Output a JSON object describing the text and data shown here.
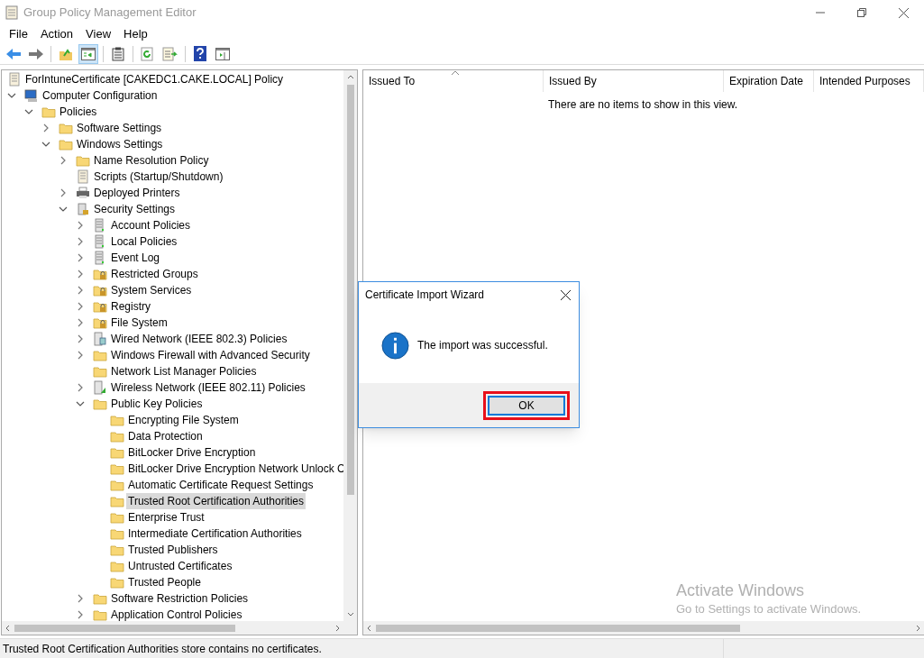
{
  "window": {
    "title": "Group Policy Management Editor"
  },
  "menu": [
    "File",
    "Action",
    "View",
    "Help"
  ],
  "toolbar": [
    {
      "kind": "back",
      "pressed": false
    },
    {
      "kind": "forward",
      "pressed": false
    },
    {
      "kind": "separator"
    },
    {
      "kind": "up",
      "pressed": false
    },
    {
      "kind": "tree",
      "pressed": true
    },
    {
      "kind": "separator"
    },
    {
      "kind": "properties",
      "pressed": false
    },
    {
      "kind": "separator"
    },
    {
      "kind": "refresh",
      "pressed": false
    },
    {
      "kind": "export",
      "pressed": false
    },
    {
      "kind": "separator"
    },
    {
      "kind": "help",
      "pressed": false
    },
    {
      "kind": "pane",
      "pressed": false
    }
  ],
  "tree": [
    {
      "label": "ForIntuneCertificate [CAKEDC1.CAKE.LOCAL] Policy",
      "kind": "document",
      "selected": false,
      "children": [
        {
          "label": "Computer Configuration",
          "kind": "computer",
          "expanded": true,
          "selected": false,
          "children": [
            {
              "label": "Policies",
              "kind": "folder",
              "expanded": true,
              "selected": false,
              "children": [
                {
                  "label": "Software Settings",
                  "kind": "folder",
                  "expanded": false,
                  "selected": false
                },
                {
                  "label": "Windows Settings",
                  "kind": "folder",
                  "expanded": true,
                  "selected": false,
                  "children": [
                    {
                      "label": "Name Resolution Policy",
                      "kind": "folder",
                      "expanded": false,
                      "selected": false
                    },
                    {
                      "label": "Scripts (Startup/Shutdown)",
                      "kind": "document",
                      "selected": false
                    },
                    {
                      "label": "Deployed Printers",
                      "kind": "printer",
                      "expanded": false,
                      "selected": false
                    },
                    {
                      "label": "Security Settings",
                      "kind": "secure",
                      "expanded": true,
                      "selected": false,
                      "children": [
                        {
                          "label": "Account Policies",
                          "kind": "server",
                          "expanded": false,
                          "selected": false
                        },
                        {
                          "label": "Local Policies",
                          "kind": "server",
                          "expanded": false,
                          "selected": false
                        },
                        {
                          "label": "Event Log",
                          "kind": "server",
                          "expanded": false,
                          "selected": false
                        },
                        {
                          "label": "Restricted Groups",
                          "kind": "locked",
                          "expanded": false,
                          "selected": false
                        },
                        {
                          "label": "System Services",
                          "kind": "locked",
                          "expanded": false,
                          "selected": false
                        },
                        {
                          "label": "Registry",
                          "kind": "locked",
                          "expanded": false,
                          "selected": false
                        },
                        {
                          "label": "File System",
                          "kind": "locked",
                          "expanded": false,
                          "selected": false
                        },
                        {
                          "label": "Wired Network (IEEE 802.3) Policies",
                          "kind": "network",
                          "expanded": false,
                          "selected": false
                        },
                        {
                          "label": "Windows Firewall with Advanced Security",
                          "kind": "folder",
                          "expanded": false,
                          "selected": false
                        },
                        {
                          "label": "Network List Manager Policies",
                          "kind": "folder",
                          "selected": false
                        },
                        {
                          "label": "Wireless Network (IEEE 802.11) Policies",
                          "kind": "wireless",
                          "expanded": false,
                          "selected": false
                        },
                        {
                          "label": "Public Key Policies",
                          "kind": "folder",
                          "expanded": true,
                          "selected": false,
                          "children": [
                            {
                              "label": "Encrypting File System",
                              "kind": "folder",
                              "selected": false
                            },
                            {
                              "label": "Data Protection",
                              "kind": "folder",
                              "selected": false
                            },
                            {
                              "label": "BitLocker Drive Encryption",
                              "kind": "folder",
                              "selected": false
                            },
                            {
                              "label": "BitLocker Drive Encryption Network Unlock C",
                              "kind": "folder",
                              "selected": false
                            },
                            {
                              "label": "Automatic Certificate Request Settings",
                              "kind": "folder",
                              "selected": false
                            },
                            {
                              "label": "Trusted Root Certification Authorities",
                              "kind": "folder",
                              "selected": true
                            },
                            {
                              "label": "Enterprise Trust",
                              "kind": "folder",
                              "selected": false
                            },
                            {
                              "label": "Intermediate Certification Authorities",
                              "kind": "folder",
                              "selected": false
                            },
                            {
                              "label": "Trusted Publishers",
                              "kind": "folder",
                              "selected": false
                            },
                            {
                              "label": "Untrusted Certificates",
                              "kind": "folder",
                              "selected": false
                            },
                            {
                              "label": "Trusted People",
                              "kind": "folder",
                              "selected": false
                            }
                          ]
                        },
                        {
                          "label": "Software Restriction Policies",
                          "kind": "folder",
                          "expanded": false,
                          "selected": false
                        },
                        {
                          "label": "Application Control Policies",
                          "kind": "folder",
                          "expanded": false,
                          "selected": false
                        }
                      ]
                    }
                  ]
                }
              ]
            }
          ]
        }
      ]
    }
  ],
  "table": {
    "columns": [
      "Issued To",
      "Issued By",
      "Expiration Date",
      "Intended Purposes"
    ],
    "empty_message": "There are no items to show in this view."
  },
  "dialog": {
    "title": "Certificate Import Wizard",
    "message": "The import was successful.",
    "button": "OK"
  },
  "activation": {
    "title": "Activate Windows",
    "subtitle": "Go to Settings to activate Windows."
  },
  "status_bar": "Trusted Root Certification Authorities store contains no certificates."
}
